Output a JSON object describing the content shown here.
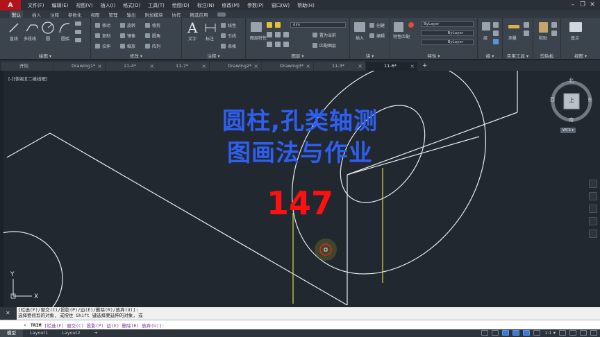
{
  "app": {
    "logo": "A"
  },
  "menu": [
    "文件(F)",
    "编辑(E)",
    "视图(V)",
    "插入(I)",
    "格式(O)",
    "工具(T)",
    "绘图(D)",
    "标注(N)",
    "修改(M)",
    "参数(P)",
    "窗口(W)",
    "帮助(H)"
  ],
  "window_controls": {
    "minimize": "–",
    "restore": "❐",
    "close": "✕"
  },
  "ribbon_tabs": [
    "默认",
    "插入",
    "注释",
    "参数化",
    "视图",
    "管理",
    "输出",
    "附加模块",
    "协作",
    "精选应用"
  ],
  "ribbon": {
    "draw": {
      "title": "绘图 ▾",
      "line": "直线",
      "polyline": "多段线",
      "circle": "圆",
      "arc": "圆弧"
    },
    "modify": {
      "title": "修改 ▾",
      "move": "移动",
      "rotate": "旋转",
      "trim": "修剪",
      "copy": "复制",
      "mirror": "镜像",
      "fillet": "圆角",
      "stretch": "拉伸",
      "scale": "缩放",
      "array": "阵列"
    },
    "annotation": {
      "title": "注释 ▾",
      "text": "文字",
      "dimension": "标注",
      "linear": "线性",
      "leader": "引线",
      "table": "表格"
    },
    "layers": {
      "title": "图层 ▾",
      "properties": "图层特性",
      "current_layer": "dim",
      "make_current": "置为当前",
      "match": "匹配图层"
    },
    "block": {
      "title": "块 ▾",
      "insert": "插入",
      "create": "创建",
      "edit": "编辑"
    },
    "properties": {
      "title": "特性 ▾",
      "match": "特性匹配",
      "color": "ByLayer",
      "linetype": "ByLayer",
      "lineweight": "ByLayer"
    },
    "groups": {
      "title": "组 ▾",
      "group": "组"
    },
    "utilities": {
      "title": "实用工具 ▾",
      "measure": "测量"
    },
    "clipboard": {
      "title": "剪贴板",
      "paste": "粘贴"
    },
    "view": {
      "title": "视图 ▾",
      "base": "基点"
    }
  },
  "doc_tabs": [
    {
      "label": "开始",
      "closable": false
    },
    {
      "label": "Drawing1*",
      "closable": true
    },
    {
      "label": "11-4*",
      "closable": true
    },
    {
      "label": "11-7*",
      "closable": true
    },
    {
      "label": "Drawing2*",
      "closable": true
    },
    {
      "label": "Drawing3*",
      "closable": true
    },
    {
      "label": "11-3*",
      "closable": true
    },
    {
      "label": "11-6*",
      "closable": true,
      "active": true
    }
  ],
  "viewport_label": "[-][俯视][二维线框]",
  "overlay": {
    "line1": "圆柱,孔类轴测",
    "line2": "图画法与作业",
    "number": "147"
  },
  "viewcube": {
    "north": "北",
    "south": "南",
    "east": "东",
    "west": "西",
    "face": "上",
    "wcs": "WCS ▾"
  },
  "ucs": {
    "y": "Y",
    "x": "X"
  },
  "command": {
    "history_line1": "[栏选(F)/窗交(C)/投影(P)/边(E)/删除(R)/放弃(U)]:",
    "history_line2": "选择要修剪的对象, 或按住 Shift 键选择要延伸的对象, 或",
    "prompt_cmd": "TRIM",
    "prompt_rest": "[栏选(F) 窗交(C) 投影(P) 边(E) 删除(R) 放弃(U)]:"
  },
  "layout_tabs": [
    "模型",
    "Layout1",
    "Layout2",
    "+"
  ],
  "status": {
    "scale": "1:1 ▾"
  },
  "colors": {
    "drawing_bg": "#212830",
    "line_white": "#e8ecf0",
    "line_yellow": "#d8dc40",
    "overlay_blue": "#2f5ff0",
    "overlay_red": "#ff1010",
    "cursor_red": "#ff2020"
  }
}
